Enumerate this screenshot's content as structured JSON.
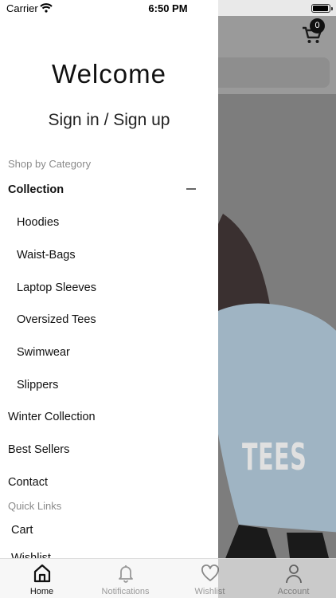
{
  "status_bar": {
    "carrier": "Carrier",
    "time": "6:50 PM"
  },
  "background": {
    "cart_count": "0",
    "banner_text": "TEES"
  },
  "drawer": {
    "welcome": "Welcome",
    "signin": "Sign in / Sign up",
    "shop_by_category_label": "Shop by Category",
    "collection": "Collection",
    "sub_items": [
      "Hoodies",
      "Waist-Bags",
      "Laptop Sleeves",
      "Oversized Tees",
      "Swimwear",
      "Slippers"
    ],
    "winter_collection": "Winter Collection",
    "best_sellers": "Best Sellers",
    "contact": "Contact",
    "quick_links_label": "Quick Links",
    "cart": "Cart",
    "wishlist": "Wishlist"
  },
  "tab_bar": {
    "items": [
      {
        "label": "Home",
        "icon": "home-icon",
        "active": true
      },
      {
        "label": "Notifications",
        "icon": "bell-icon",
        "active": false
      },
      {
        "label": "Wishlist",
        "icon": "heart-icon",
        "active": false
      },
      {
        "label": "Account",
        "icon": "user-icon",
        "active": false
      }
    ]
  },
  "colors": {
    "text": "#111111",
    "section_label": "#8a8a8a",
    "tab_inactive": "#999999",
    "overlay": "#7d7d7d"
  }
}
